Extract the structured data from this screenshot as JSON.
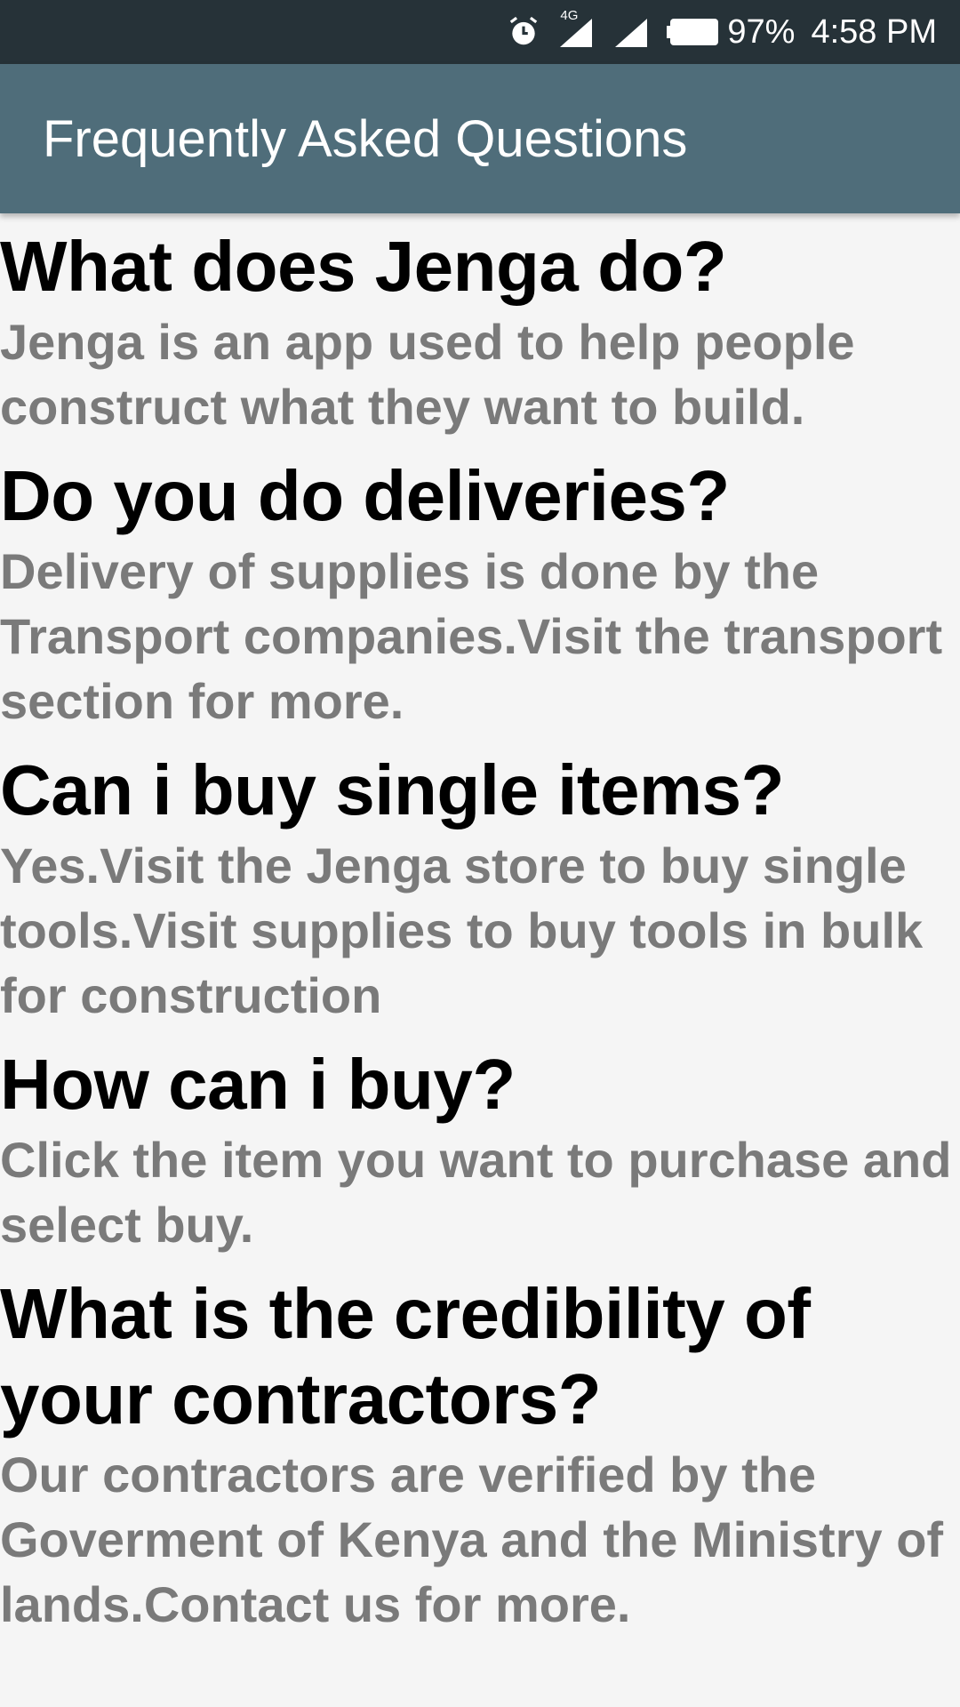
{
  "status_bar": {
    "network_label": "4G",
    "battery_percent": "97%",
    "time": "4:58 PM",
    "icons": [
      "alarm-icon",
      "signal-icon",
      "signal-icon",
      "battery-icon"
    ]
  },
  "app_bar": {
    "title": "Frequently Asked Questions"
  },
  "faq": [
    {
      "question": "What does Jenga do?",
      "answer": "Jenga is an app used to help people construct what they want to build."
    },
    {
      "question": "Do you do deliveries?",
      "answer": "Delivery of supplies is done by the Transport companies.Visit the transport section for more."
    },
    {
      "question": "Can i buy single items?",
      "answer": "Yes.Visit the Jenga store to buy single tools.Visit supplies to buy tools in bulk for construction"
    },
    {
      "question": "How can i buy?",
      "answer": "Click the item you want to purchase and select buy."
    },
    {
      "question": "What is the credibility of your contractors?",
      "answer": "Our contractors are verified by the Goverment of Kenya and the Ministry of lands.Contact us for more."
    }
  ],
  "colors": {
    "status_bar": "#263238",
    "app_bar": "#4f6d7a",
    "question": "#000000",
    "answer": "#7a7a7a",
    "cut_off_text": "#e53935"
  }
}
